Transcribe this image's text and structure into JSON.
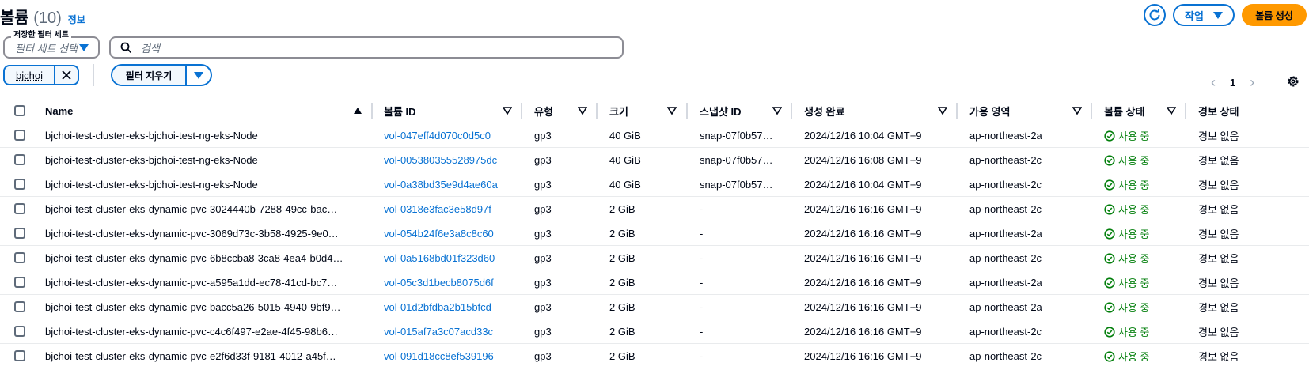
{
  "header": {
    "title": "볼륨",
    "count": "(10)",
    "info_link": "정보",
    "action_label": "작업",
    "create_label": "볼륨 생성"
  },
  "filters": {
    "saved_filter_label": "저장한 필터 세트",
    "saved_filter_placeholder": "필터 세트 선택",
    "search_placeholder": "검색",
    "token_label": "bjchoi",
    "clear_label": "필터 지우기"
  },
  "pagination": {
    "current_page": "1"
  },
  "table": {
    "columns": [
      "Name",
      "볼륨 ID",
      "유형",
      "크기",
      "스냅샷 ID",
      "생성 완료",
      "가용 영역",
      "볼륨 상태",
      "경보 상태"
    ],
    "rows": [
      {
        "name": "bjchoi-test-cluster-eks-bjchoi-test-ng-eks-Node",
        "volume_id": "vol-047eff4d070c0d5c0",
        "type": "gp3",
        "size": "40 GiB",
        "snapshot": "snap-07f0b57…",
        "created": "2024/12/16 10:04 GMT+9",
        "az": "ap-northeast-2a",
        "status": "사용 중",
        "alarm": "경보 없음"
      },
      {
        "name": "bjchoi-test-cluster-eks-bjchoi-test-ng-eks-Node",
        "volume_id": "vol-005380355528975dc",
        "type": "gp3",
        "size": "40 GiB",
        "snapshot": "snap-07f0b57…",
        "created": "2024/12/16 16:08 GMT+9",
        "az": "ap-northeast-2c",
        "status": "사용 중",
        "alarm": "경보 없음"
      },
      {
        "name": "bjchoi-test-cluster-eks-bjchoi-test-ng-eks-Node",
        "volume_id": "vol-0a38bd35e9d4ae60a",
        "type": "gp3",
        "size": "40 GiB",
        "snapshot": "snap-07f0b57…",
        "created": "2024/12/16 10:04 GMT+9",
        "az": "ap-northeast-2c",
        "status": "사용 중",
        "alarm": "경보 없음"
      },
      {
        "name": "bjchoi-test-cluster-eks-dynamic-pvc-3024440b-7288-49cc-bac…",
        "volume_id": "vol-0318e3fac3e58d97f",
        "type": "gp3",
        "size": "2 GiB",
        "snapshot": "-",
        "created": "2024/12/16 16:16 GMT+9",
        "az": "ap-northeast-2c",
        "status": "사용 중",
        "alarm": "경보 없음"
      },
      {
        "name": "bjchoi-test-cluster-eks-dynamic-pvc-3069d73c-3b58-4925-9e0…",
        "volume_id": "vol-054b24f6e3a8c8c60",
        "type": "gp3",
        "size": "2 GiB",
        "snapshot": "-",
        "created": "2024/12/16 16:16 GMT+9",
        "az": "ap-northeast-2a",
        "status": "사용 중",
        "alarm": "경보 없음"
      },
      {
        "name": "bjchoi-test-cluster-eks-dynamic-pvc-6b8ccba8-3ca8-4ea4-b0d4…",
        "volume_id": "vol-0a5168bd01f323d60",
        "type": "gp3",
        "size": "2 GiB",
        "snapshot": "-",
        "created": "2024/12/16 16:16 GMT+9",
        "az": "ap-northeast-2c",
        "status": "사용 중",
        "alarm": "경보 없음"
      },
      {
        "name": "bjchoi-test-cluster-eks-dynamic-pvc-a595a1dd-ec78-41cd-bc7…",
        "volume_id": "vol-05c3d1becb8075d6f",
        "type": "gp3",
        "size": "2 GiB",
        "snapshot": "-",
        "created": "2024/12/16 16:16 GMT+9",
        "az": "ap-northeast-2a",
        "status": "사용 중",
        "alarm": "경보 없음"
      },
      {
        "name": "bjchoi-test-cluster-eks-dynamic-pvc-bacc5a26-5015-4940-9bf9…",
        "volume_id": "vol-01d2bfdba2b15bfcd",
        "type": "gp3",
        "size": "2 GiB",
        "snapshot": "-",
        "created": "2024/12/16 16:16 GMT+9",
        "az": "ap-northeast-2a",
        "status": "사용 중",
        "alarm": "경보 없음"
      },
      {
        "name": "bjchoi-test-cluster-eks-dynamic-pvc-c4c6f497-e2ae-4f45-98b6…",
        "volume_id": "vol-015af7a3c07acd33c",
        "type": "gp3",
        "size": "2 GiB",
        "snapshot": "-",
        "created": "2024/12/16 16:16 GMT+9",
        "az": "ap-northeast-2c",
        "status": "사용 중",
        "alarm": "경보 없음"
      },
      {
        "name": "bjchoi-test-cluster-eks-dynamic-pvc-e2f6d33f-9181-4012-a45f…",
        "volume_id": "vol-091d18cc8ef539196",
        "type": "gp3",
        "size": "2 GiB",
        "snapshot": "-",
        "created": "2024/12/16 16:16 GMT+9",
        "az": "ap-northeast-2c",
        "status": "사용 중",
        "alarm": "경보 없음"
      }
    ]
  },
  "colors": {
    "link": "#0972d3",
    "primary_button": "#ff9900",
    "status_ok": "#037f0c",
    "border": "#8c8c94"
  },
  "icons": {
    "refresh": "refresh-icon",
    "settings": "gear-icon",
    "search": "search-icon",
    "status": "check-circle-icon"
  }
}
